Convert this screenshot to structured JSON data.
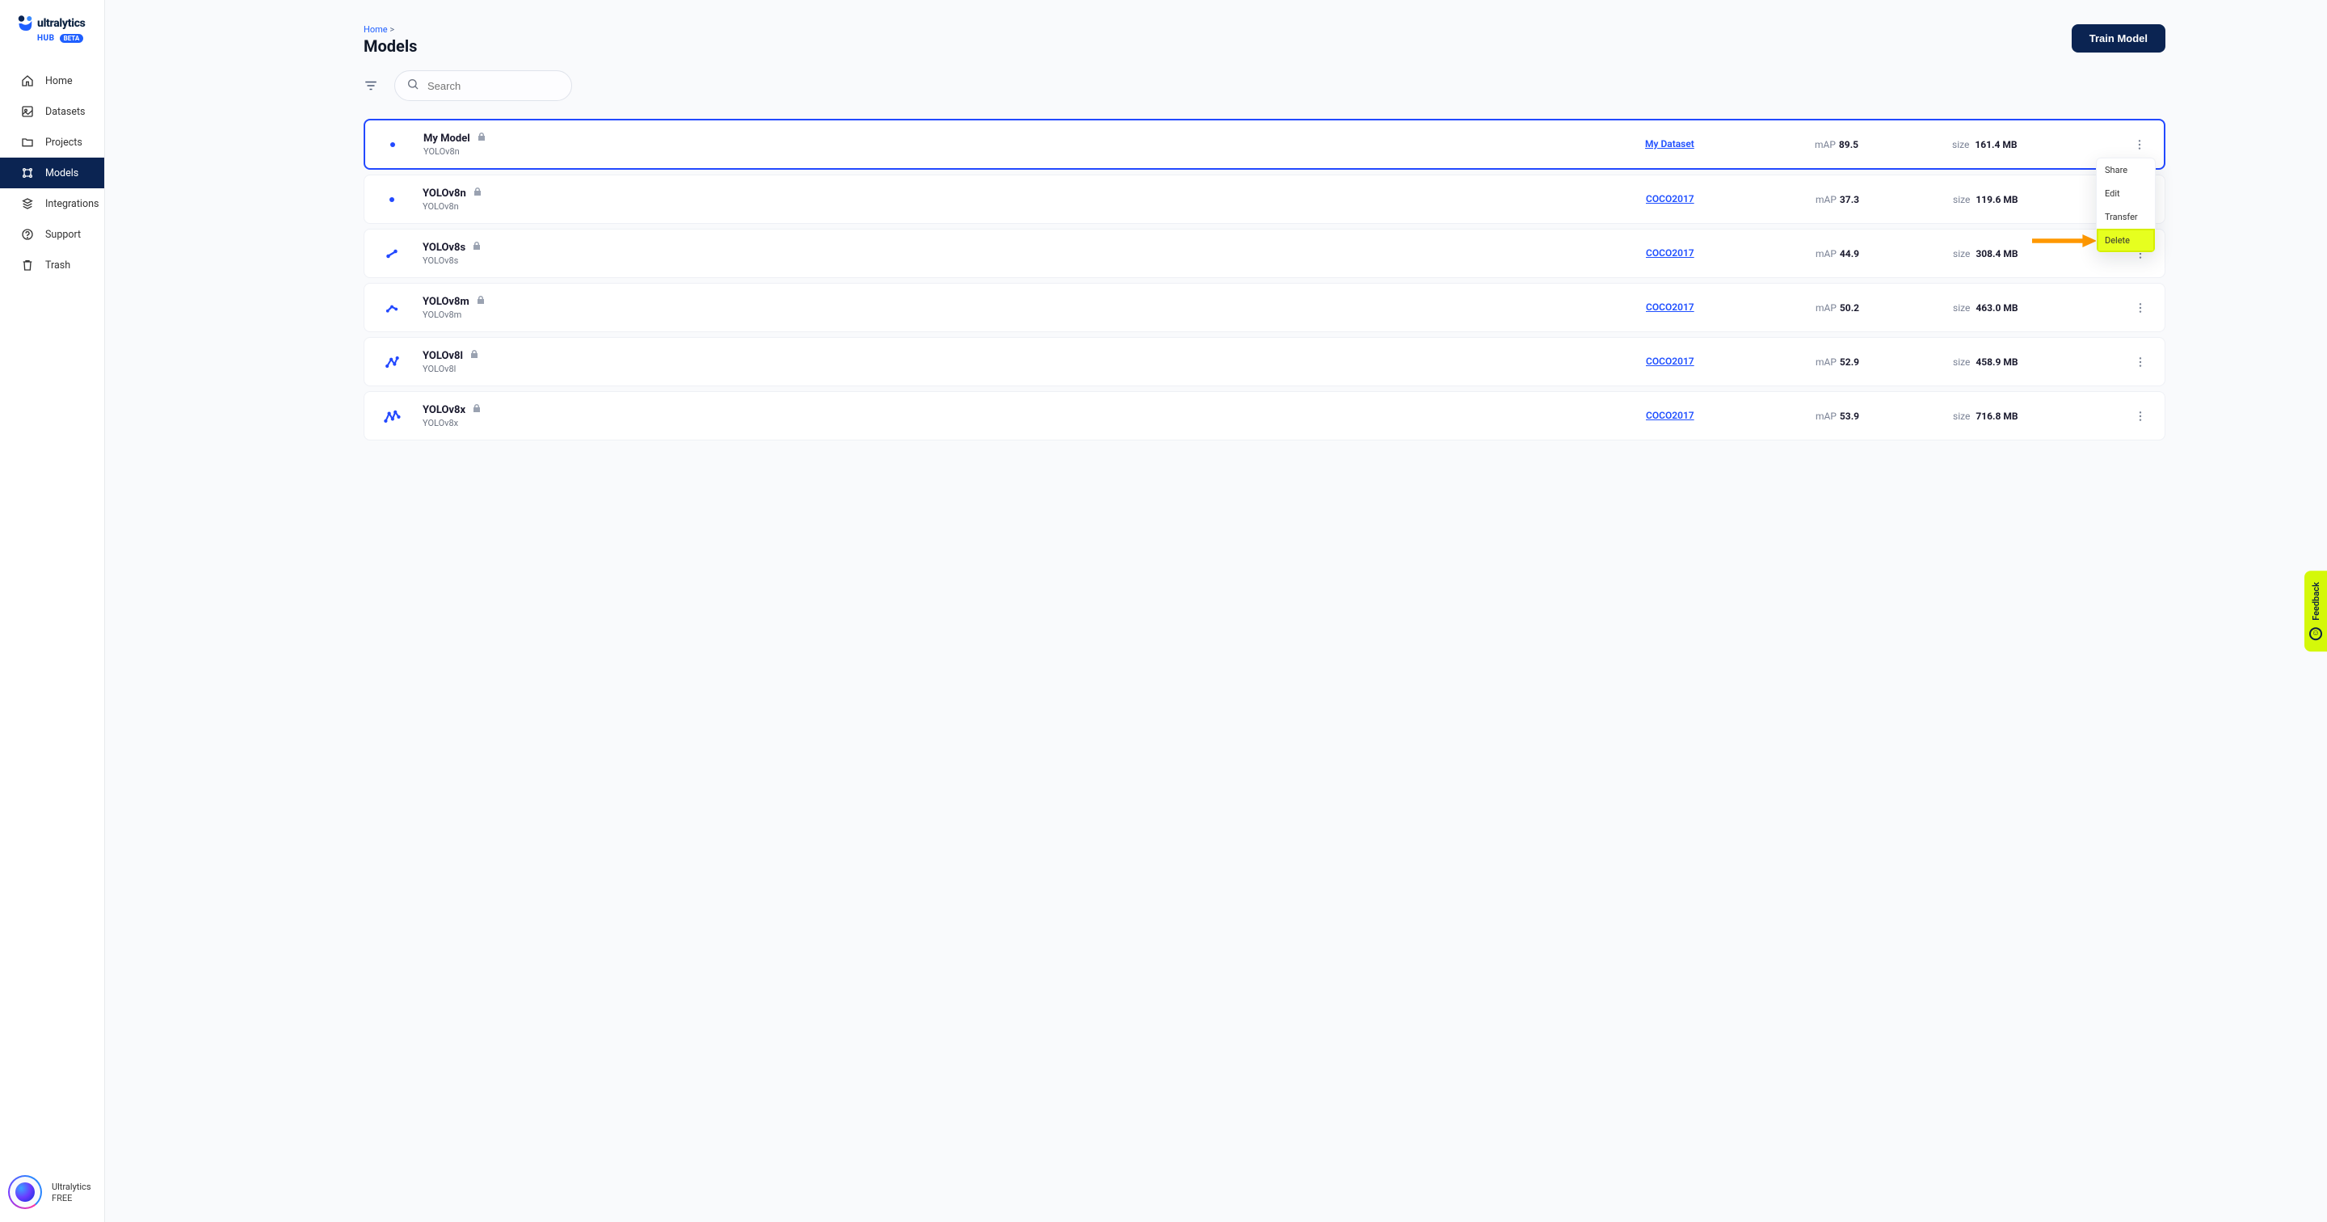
{
  "brand": {
    "name": "ultralytics",
    "sub": "HUB",
    "badge": "BETA"
  },
  "sidebar": {
    "items": [
      {
        "label": "Home",
        "icon": "home"
      },
      {
        "label": "Datasets",
        "icon": "dataset"
      },
      {
        "label": "Projects",
        "icon": "folder"
      },
      {
        "label": "Models",
        "icon": "models",
        "active": true
      },
      {
        "label": "Integrations",
        "icon": "integrations"
      },
      {
        "label": "Support",
        "icon": "support"
      },
      {
        "label": "Trash",
        "icon": "trash"
      }
    ],
    "user": {
      "name": "Ultralytics",
      "plan": "FREE"
    }
  },
  "breadcrumb": {
    "home": "Home",
    "sep": ">"
  },
  "page": {
    "title": "Models"
  },
  "actions": {
    "train": "Train Model"
  },
  "search": {
    "placeholder": "Search"
  },
  "dropdown": {
    "share": "Share",
    "edit": "Edit",
    "transfer": "Transfer",
    "delete": "Delete"
  },
  "metric_labels": {
    "map": "mAP",
    "size": "size"
  },
  "models": [
    {
      "name": "My Model",
      "arch": "YOLOv8n",
      "dataset": "My Dataset",
      "map": "89.5",
      "size": "161.4 MB",
      "icon": "dot",
      "selected": true
    },
    {
      "name": "YOLOv8n",
      "arch": "YOLOv8n",
      "dataset": "COCO2017",
      "map": "37.3",
      "size": "119.6 MB",
      "icon": "dot"
    },
    {
      "name": "YOLOv8s",
      "arch": "YOLOv8s",
      "dataset": "COCO2017",
      "map": "44.9",
      "size": "308.4 MB",
      "icon": "line1"
    },
    {
      "name": "YOLOv8m",
      "arch": "YOLOv8m",
      "dataset": "COCO2017",
      "map": "50.2",
      "size": "463.0 MB",
      "icon": "line2"
    },
    {
      "name": "YOLOv8l",
      "arch": "YOLOv8l",
      "dataset": "COCO2017",
      "map": "52.9",
      "size": "458.9 MB",
      "icon": "squiggle"
    },
    {
      "name": "YOLOv8x",
      "arch": "YOLOv8x",
      "dataset": "COCO2017",
      "map": "53.9",
      "size": "716.8 MB",
      "icon": "bigsquiggle"
    }
  ],
  "feedback": {
    "label": "Feedback"
  }
}
